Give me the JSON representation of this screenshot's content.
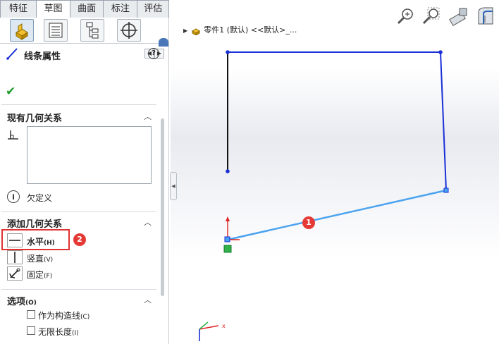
{
  "tabs": [
    {
      "label": "特征",
      "active": false
    },
    {
      "label": "草图",
      "active": true
    },
    {
      "label": "曲面",
      "active": false
    },
    {
      "label": "标注",
      "active": false
    },
    {
      "label": "评估",
      "active": false
    }
  ],
  "panel": {
    "title": "线条属性",
    "help_label": "?",
    "ok_label": "✔",
    "existing_relations": {
      "title": "现有几何关系",
      "status": "欠定义"
    },
    "add_relations": {
      "title": "添加几何关系",
      "items": [
        {
          "label": "水平",
          "shortcut": "(H)"
        },
        {
          "label": "竖直",
          "shortcut": "(V)"
        },
        {
          "label": "固定",
          "shortcut": "(F)"
        }
      ]
    },
    "options": {
      "title": "选项",
      "title_shortcut": "(O)",
      "items": [
        {
          "label": "作为构造线",
          "shortcut": "(C)",
          "checked": false
        },
        {
          "label": "无限长度",
          "shortcut": "(I)",
          "checked": false
        }
      ]
    }
  },
  "badges": {
    "one": "1",
    "two": "2"
  },
  "feature_tree": {
    "text": "零件1 (默认) <<默认>_..."
  },
  "colors": {
    "sketch_blue": "#1a2fd6",
    "selected_line": "#4aa3f0",
    "badge_red": "#e53935",
    "highlight_red": "#e03232"
  }
}
